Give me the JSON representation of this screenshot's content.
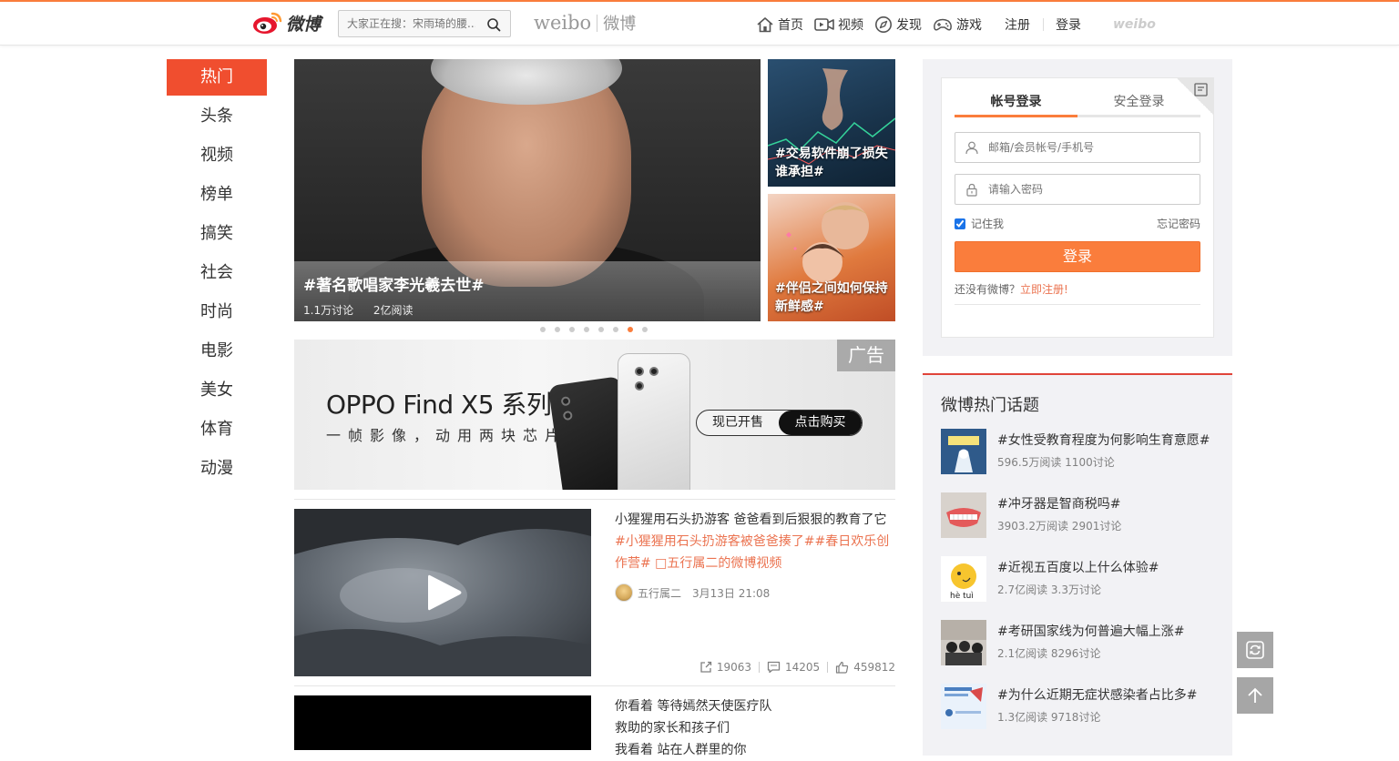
{
  "header": {
    "logo_text": "微博",
    "search_placeholder": "大家正在搜：宋雨琦的腰...",
    "brand_en": "weibo",
    "brand_cn": "微博",
    "nav": {
      "home": "首页",
      "video": "视频",
      "discover": "发现",
      "game": "游戏",
      "register": "注册",
      "login": "登录",
      "logo": "weibo"
    }
  },
  "channels": [
    "热门",
    "头条",
    "视频",
    "榜单",
    "搞笑",
    "社会",
    "时尚",
    "电影",
    "美女",
    "体育",
    "动漫"
  ],
  "carousel": {
    "main": {
      "title": "#著名歌唱家李光羲去世#",
      "discuss": "1.1万讨论",
      "read": "2亿阅读"
    },
    "side1": "#交易软件崩了损失谁承担#",
    "side2": "#伴侣之间如何保持新鲜感#",
    "dots_total": 8,
    "dots_active_index": 6
  },
  "ad": {
    "tag": "广告",
    "title": "OPPO Find X5 系列",
    "subtitle": "一帧影像，动用两块芯片",
    "btn_onsale": "现已开售",
    "btn_buy": "点击购买"
  },
  "feed": [
    {
      "text": "小猩猩用石头扔游客 爸爸看到后狠狠的教育了它",
      "tags": "#小猩猩用石头扔游客被爸爸揍了##春日欢乐创作营# □五行属二的微博视频",
      "user": "五行属二",
      "time": "3月13日 21:08",
      "forward": "19063",
      "comment": "14205",
      "like": "459812"
    },
    {
      "line1": "你看着 等待嫣然天使医疗队",
      "line2": "救助的家长和孩子们",
      "line3": "我看着 站在人群里的你"
    }
  ],
  "login": {
    "tab_account": "帐号登录",
    "tab_secure": "安全登录",
    "username_placeholder": "邮箱/会员帐号/手机号",
    "password_placeholder": "请输入密码",
    "remember": "记住我",
    "forgot": "忘记密码",
    "submit": "登录",
    "register_prompt": "还没有微博？",
    "register_link": "立即注册!"
  },
  "hot_topics": {
    "title": "微博热门话题",
    "items": [
      {
        "name": "#女性受教育程度为何影响生育意愿#",
        "meta": "596.5万阅读 1100讨论"
      },
      {
        "name": "#冲牙器是智商税吗#",
        "meta": "3903.2万阅读 2901讨论"
      },
      {
        "name": "#近视五百度以上什么体验#",
        "meta": "2.7亿阅读 3.3万讨论"
      },
      {
        "name": "#考研国家线为何普遍大幅上涨#",
        "meta": "2.1亿阅读 8296讨论"
      },
      {
        "name": "#为什么近期无症状感染者占比多#",
        "meta": "1.3亿阅读 9718讨论"
      }
    ]
  },
  "colors": {
    "accent": "#fa7d3c",
    "channel_active": "#f04e2f",
    "link": "#eb7350",
    "hot_border": "#e0443a"
  }
}
